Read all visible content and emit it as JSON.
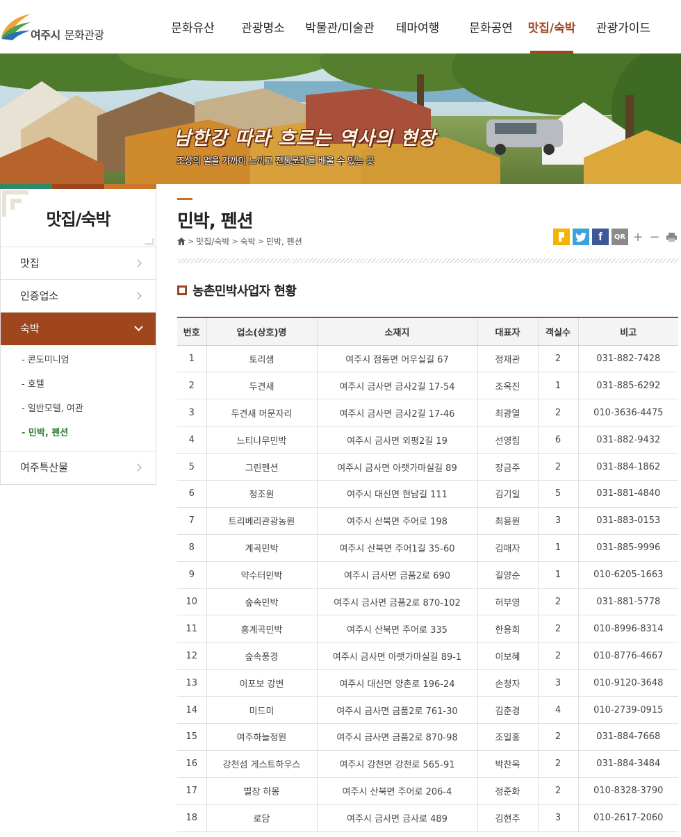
{
  "header": {
    "logo_city": "여주시",
    "logo_text": "문화관광",
    "nav": [
      {
        "label": "문화유산",
        "active": false
      },
      {
        "label": "관광명소",
        "active": false
      },
      {
        "label": "박물관/미술관",
        "active": false
      },
      {
        "label": "테마여행",
        "active": false
      },
      {
        "label": "문화공연",
        "active": false
      },
      {
        "label": "맛집/숙박",
        "active": true
      },
      {
        "label": "관광가이드",
        "active": false
      }
    ]
  },
  "banner": {
    "title": "남한강 따라 흐르는 역사의 현장",
    "subtitle": "조상의 얼을 가까이 느끼고 전통문화를 배울 수 있는 곳"
  },
  "sidebar": {
    "title": "맛집/숙박",
    "items": [
      {
        "label": "맛집",
        "active": false
      },
      {
        "label": "인증업소",
        "active": false
      },
      {
        "label": "숙박",
        "active": true
      },
      {
        "label": "여주특산물",
        "active": false
      }
    ],
    "subitems": [
      {
        "label": "- 콘도미니엄",
        "active": false
      },
      {
        "label": "- 호텔",
        "active": false
      },
      {
        "label": "- 일반모텔, 여관",
        "active": false
      },
      {
        "label": "- 민박, 펜션",
        "active": true
      }
    ]
  },
  "content": {
    "page_title": "민박, 펜션",
    "breadcrumb": [
      "맛집/숙박",
      "숙박",
      "민박, 펜션"
    ],
    "share": {
      "qr_label": "QR",
      "plus": "+",
      "minus": "−"
    },
    "section_title": "농촌민박사업자 현황",
    "table": {
      "headers": [
        "번호",
        "업소(상호)명",
        "소재지",
        "대표자",
        "객실수",
        "비고"
      ],
      "rows": [
        [
          "1",
          "토리샘",
          "여주시 점동면 어우실길 67",
          "정재관",
          "2",
          "031-882-7428"
        ],
        [
          "2",
          "두견새",
          "여주시 금사면 금사2길 17-54",
          "조옥진",
          "1",
          "031-885-6292"
        ],
        [
          "3",
          "두견새 머문자리",
          "여주시 금사면 금사2길 17-46",
          "최광열",
          "2",
          "010-3636-4475"
        ],
        [
          "4",
          "느티나무민박",
          "여주시 금사면 외평2길 19",
          "선영림",
          "6",
          "031-882-9432"
        ],
        [
          "5",
          "그린펜션",
          "여주시 금사면 아랫가마실길 89",
          "장금주",
          "2",
          "031-884-1862"
        ],
        [
          "6",
          "청조원",
          "여주시 대신면 현남길 111",
          "김기일",
          "5",
          "031-881-4840"
        ],
        [
          "7",
          "트리베리관광농원",
          "여주시 산북면 주어로 198",
          "최용원",
          "3",
          "031-883-0153"
        ],
        [
          "8",
          "계곡민박",
          "여주시 산북면 주어1길 35-60",
          "김매자",
          "1",
          "031-885-9996"
        ],
        [
          "9",
          "약수터민박",
          "여주시 금사면 금품2로 690",
          "길양순",
          "1",
          "010-6205-1663"
        ],
        [
          "10",
          "숲속민박",
          "여주시 금사면 금품2로 870-102",
          "허부영",
          "2",
          "031-881-5778"
        ],
        [
          "11",
          "홍계곡민박",
          "여주시 산북면 주어로 335",
          "한용희",
          "2",
          "010-8996-8314"
        ],
        [
          "12",
          "숲속풍경",
          "여주시 금사면 아랫가마실길 89-1",
          "이보혜",
          "2",
          "010-8776-4667"
        ],
        [
          "13",
          "이포보 강변",
          "여주시 대신면 양촌로 196-24",
          "손청자",
          "3",
          "010-9120-3648"
        ],
        [
          "14",
          "미드미",
          "여주시 금사면 금품2로 761-30",
          "김춘경",
          "4",
          "010-2739-0915"
        ],
        [
          "15",
          "여주하늘정원",
          "여주시 금사면 금품2로 870-98",
          "조일홍",
          "2",
          "031-884-7668"
        ],
        [
          "16",
          "강천섬 게스트하우스",
          "여주시 강천면 강천로 565-91",
          "박찬옥",
          "2",
          "031-884-3484"
        ],
        [
          "17",
          "별장 하몽",
          "여주시 산북면 주어로 206-4",
          "정준화",
          "2",
          "010-8328-3790"
        ],
        [
          "18",
          "로담",
          "여주시 금사면 금사로 489",
          "김현주",
          "3",
          "010-2617-2060"
        ]
      ]
    }
  },
  "colors": {
    "accent": "#a0461e",
    "sub_active": "#2e7d32",
    "topbar": [
      "#2f8a6a",
      "#a0461e",
      "#c9782e"
    ],
    "kakao": "#f5b400",
    "twitter": "#3aa3d9",
    "facebook": "#3b5998",
    "qr": "#8a8a8a"
  }
}
